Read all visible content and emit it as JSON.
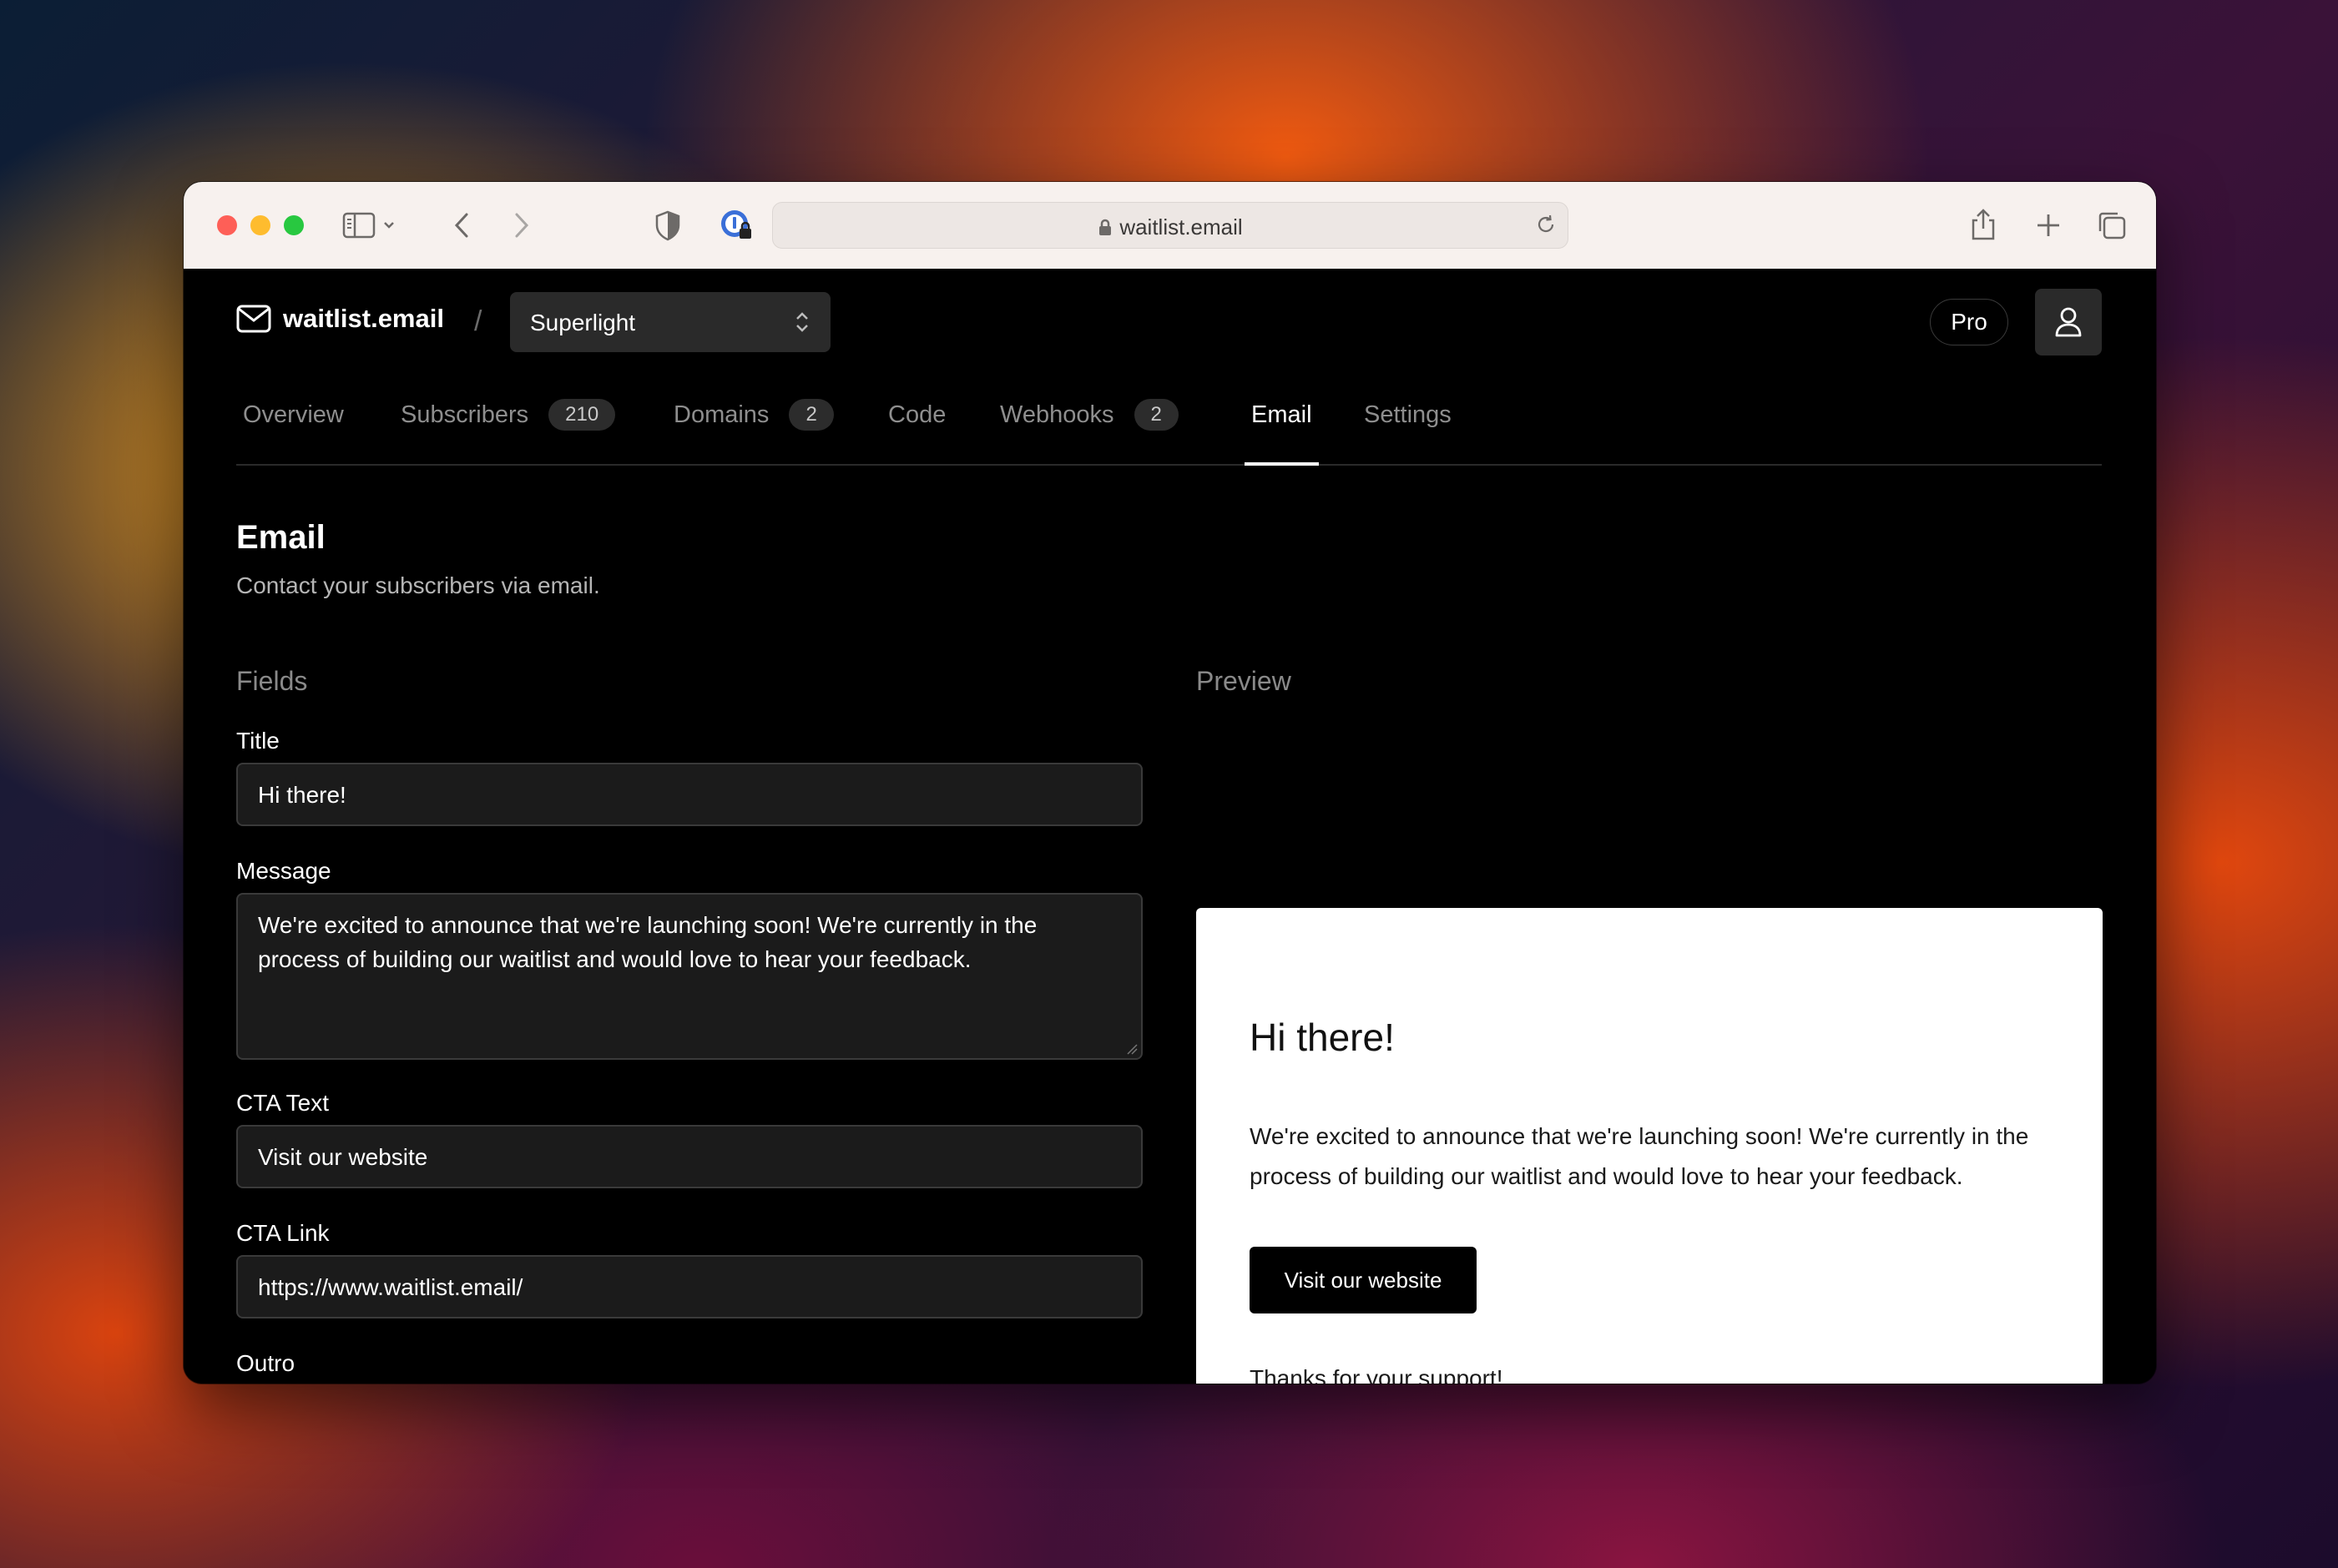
{
  "browser": {
    "url": "waitlist.email"
  },
  "app": {
    "brand": "waitlist.email",
    "separator": "/",
    "project": "Superlight",
    "plan_badge": "Pro"
  },
  "tabs": [
    {
      "label": "Overview",
      "count": null
    },
    {
      "label": "Subscribers",
      "count": "210"
    },
    {
      "label": "Domains",
      "count": "2"
    },
    {
      "label": "Code",
      "count": null
    },
    {
      "label": "Webhooks",
      "count": "2"
    },
    {
      "label": "Email",
      "count": null,
      "active": true
    },
    {
      "label": "Settings",
      "count": null
    }
  ],
  "header": {
    "title": "Email",
    "subtitle": "Contact your subscribers via email."
  },
  "fields": {
    "section_label": "Fields",
    "title_label": "Title",
    "title_value": "Hi there!",
    "message_label": "Message",
    "message_value": "We're excited to announce that we're launching soon! We're currently in the process of building our waitlist and would love to hear your feedback.",
    "cta_text_label": "CTA Text",
    "cta_text_value": "Visit our website",
    "cta_link_label": "CTA Link",
    "cta_link_value": "https://www.waitlist.email/",
    "outro_label": "Outro"
  },
  "preview": {
    "section_label": "Preview",
    "title": "Hi there!",
    "message": "We're excited to announce that we're launching soon! We're currently in the process of building our waitlist and would love to hear your feedback.",
    "cta": "Visit our website",
    "outro": "Thanks for your support!"
  },
  "colors": {
    "page_bg": "#000000",
    "input_bg": "#1b1b1b",
    "accent": "#ffffff",
    "traffic_red": "#fe5f57",
    "traffic_yellow": "#febc2e",
    "traffic_green": "#28c840"
  }
}
